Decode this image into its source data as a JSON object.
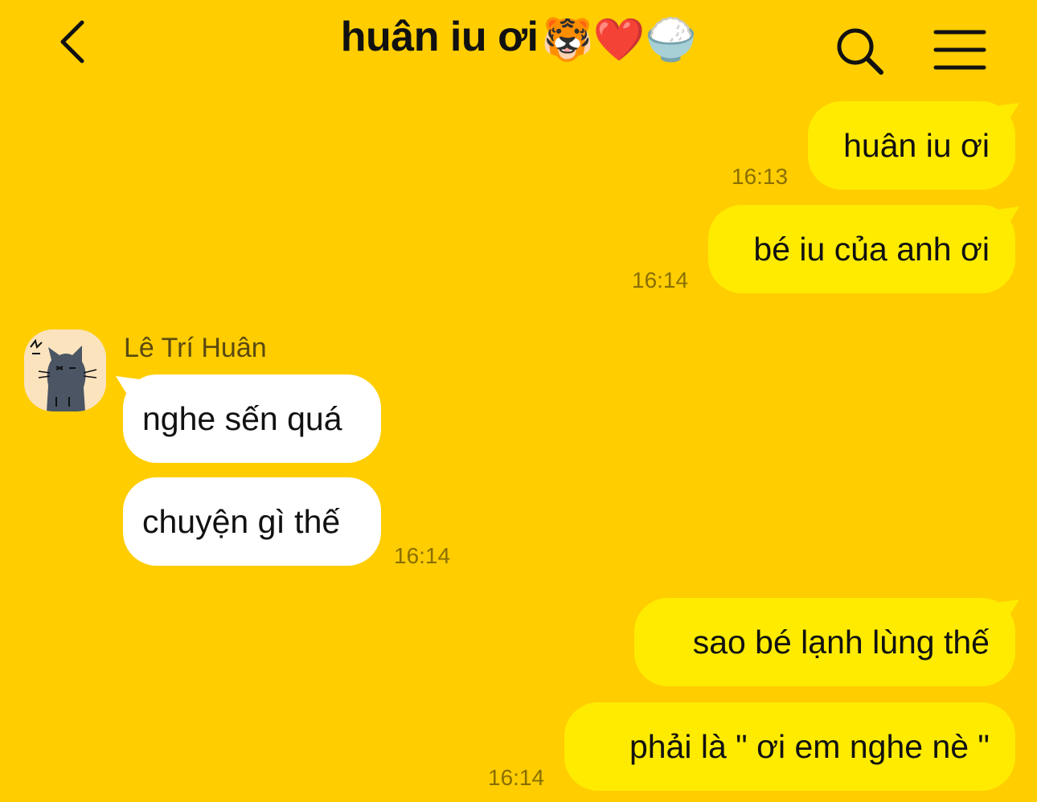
{
  "header": {
    "title": "huân iu ơi",
    "title_emojis": "🐯❤️🍚",
    "back_icon": "chevron-left-icon",
    "search_icon": "search-icon",
    "menu_icon": "hamburger-menu-icon"
  },
  "colors": {
    "background": "#FFCD00",
    "my_bubble": "#FFEB00",
    "their_bubble": "#FFFFFF",
    "timestamp": "#8a6f00"
  },
  "contact": {
    "name": "Lê Trí Huân",
    "avatar_icon": "cat-avatar-icon"
  },
  "messages": [
    {
      "sender": "me",
      "text": "huân iu ơi",
      "time": "16:13"
    },
    {
      "sender": "me",
      "text": "bé iu của anh ơi",
      "time": "16:14"
    },
    {
      "sender": "them",
      "text": "nghe sến quá",
      "time": ""
    },
    {
      "sender": "them",
      "text": "chuyện gì thế",
      "time": "16:14"
    },
    {
      "sender": "me",
      "text": "sao bé lạnh lùng thế",
      "time": ""
    },
    {
      "sender": "me",
      "text": "phải là \" ơi em nghe nè \"",
      "time": "16:14"
    }
  ]
}
